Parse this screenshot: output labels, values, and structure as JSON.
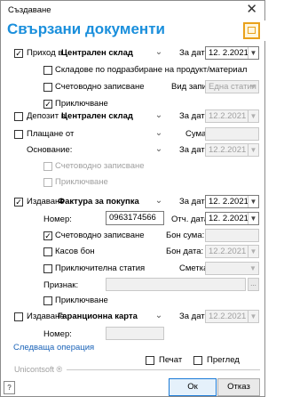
{
  "window": {
    "title": "Създаване",
    "close_glyph": "✕"
  },
  "header": {
    "title": "Свързани документи",
    "icon": "document-link-icon"
  },
  "receipt": {
    "label_prefix": "Приход в",
    "warehouse": "Централен склад",
    "date_label": "За дата:",
    "date": "12.  2.2021",
    "checked": true,
    "default_warehouses_label": "Складове по подразбиране на продукт/материал",
    "default_warehouses_checked": false,
    "accounting_label": "Счетоводно записване",
    "accounting_checked": false,
    "entry_type_label": "Вид запис:",
    "entry_type_value": "Една статия",
    "close_label": "Приключване",
    "close_checked": true
  },
  "deposit": {
    "label_prefix": "Депозит в",
    "warehouse": "Централен склад",
    "date_label": "За дата:",
    "date": "12.2.2021",
    "checked": false
  },
  "payment": {
    "label": "Плащане от",
    "amount_label": "Сума:",
    "basis_label": "Основание:",
    "date_label": "За дата:",
    "date": "12.2.2021",
    "checked": false,
    "accounting_label": "Счетоводно записване",
    "close_label": "Приключване"
  },
  "invoice": {
    "label_prefix": "Издаване",
    "doc_type": "Фактура за покупка",
    "date_label": "За дата:",
    "date": "12.  2.2021",
    "checked": true,
    "number_label": "Номер:",
    "number_value": "0963174566",
    "report_date_label": "Отч. дата:",
    "report_date": "12.  2.2021",
    "accounting_label": "Счетоводно записване",
    "accounting_checked": true,
    "bon_amount_label": "Бон сума:",
    "cash_bon_label": "Касов бон",
    "cash_bon_checked": false,
    "bon_date_label": "Бон дата:",
    "bon_date": "12.2.2021",
    "closing_article_label": "Приключителна статия",
    "closing_article_checked": false,
    "account_label": "Сметка:",
    "sign_label": "Признак:",
    "close_label": "Приключване",
    "close_checked": false
  },
  "warranty": {
    "label_prefix": "Издаване",
    "doc_type": "Гаранционна карта",
    "date_label": "За дата:",
    "date": "12.2.2021",
    "checked": false,
    "number_label": "Номер:"
  },
  "next_operation": "Следваща операция",
  "footer": {
    "brand": "Unicontsoft ®",
    "print_label": "Печат",
    "print_checked": false,
    "preview_label": "Преглед",
    "preview_checked": false,
    "ok_label": "Ок",
    "cancel_label": "Отказ",
    "help_glyph": "?"
  }
}
